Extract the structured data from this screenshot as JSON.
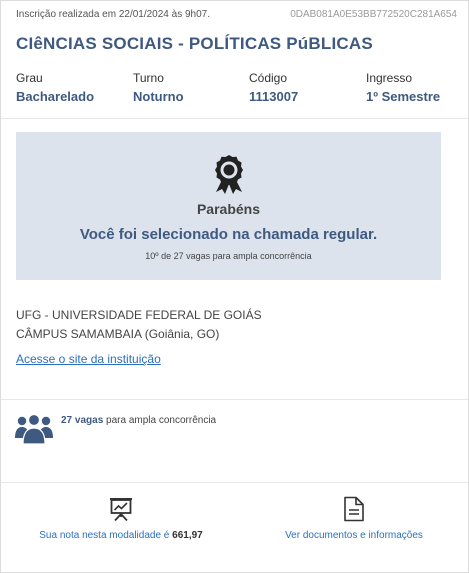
{
  "header": {
    "registration_text": "Inscrição realizada em 22/01/2024 às 9h07.",
    "registration_code": "0DAB081A0E53BB772520C281A654",
    "course_title": "CIêNCIAS SOCIAIS - POLÍTICAS PúBLICAS"
  },
  "info": [
    {
      "label": "Grau",
      "value": "Bacharelado"
    },
    {
      "label": "Turno",
      "value": "Noturno"
    },
    {
      "label": "Código",
      "value": "1113007"
    },
    {
      "label": "Ingresso",
      "value": "1º Semestre"
    }
  ],
  "result": {
    "icon": "award-ribbon-icon",
    "congrats": "Parabéns",
    "message": "Você foi selecionado na chamada regular.",
    "rank": "10º de 27 vagas para ampla concorrência"
  },
  "institution": {
    "name": "UFG - UNIVERSIDADE FEDERAL DE GOIÁS",
    "campus": "CÂMPUS SAMAMBAIA (Goiânia, GO)",
    "link_text": "Acesse o site da instituição"
  },
  "vacancies": {
    "icon": "people-group-icon",
    "count_text": "27 vagas",
    "suffix": "para ampla concorrência"
  },
  "bottom": {
    "score": {
      "icon": "presentation-chart-icon",
      "text": "Sua nota nesta modalidade é",
      "value": "661,97"
    },
    "documents": {
      "icon": "document-icon",
      "text": "Ver documentos e informações"
    }
  },
  "colors": {
    "accent": "#3f5a80",
    "link": "#2b6fbf",
    "result_bg": "#dde3ec"
  }
}
